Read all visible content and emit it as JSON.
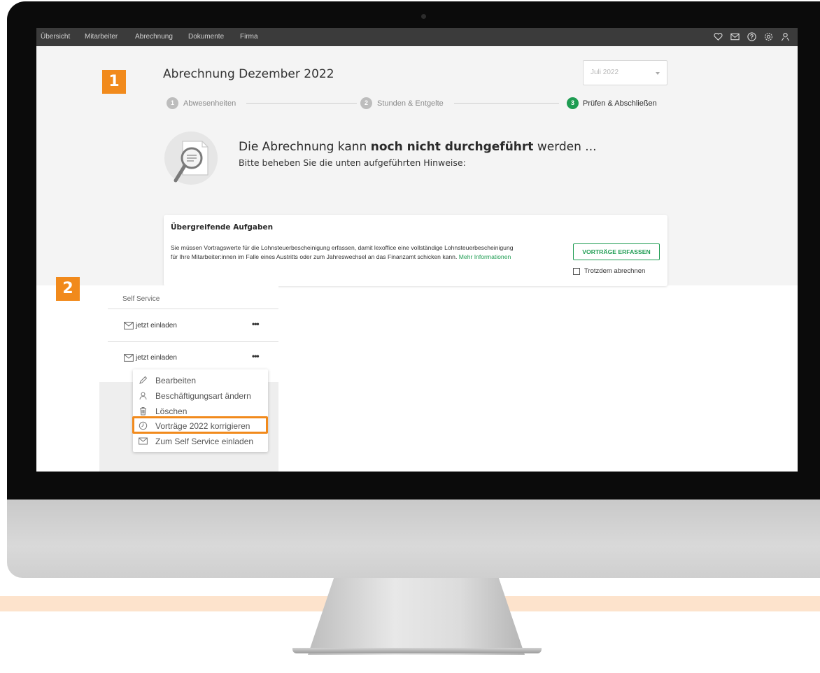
{
  "nav": {
    "items": [
      "Übersicht",
      "Mitarbeiter",
      "Abrechnung",
      "Dokumente",
      "Firma"
    ],
    "icons": [
      "heart-icon",
      "mail-icon",
      "help-icon",
      "settings-icon",
      "user-icon"
    ]
  },
  "badges": {
    "first": "1",
    "second": "2"
  },
  "page": {
    "title": "Abrechnung Dezember 2022",
    "month_select": "Juli 2022"
  },
  "stepper": {
    "steps": [
      {
        "number": "1",
        "label": "Abwesenheiten"
      },
      {
        "number": "2",
        "label": "Stunden & Entgelte"
      },
      {
        "number": "3",
        "label": "Prüfen & Abschließen"
      }
    ]
  },
  "notice": {
    "headline_pre": "Die Abrechnung kann ",
    "headline_bold": "noch nicht durchgeführt",
    "headline_post": " werden ...",
    "subline": "Bitte beheben Sie die unten aufgeführten Hinweise:"
  },
  "task": {
    "title": "Übergreifende Aufgaben",
    "text": "Sie müssen Vortragswerte für die Lohnsteuerbescheinigung erfassen, damit lexoffice eine vollständige Lohnsteuerbescheinigung für Ihre Mitarbeiter:innen im Falle eines Austritts oder zum Jahreswechsel an das Finanzamt schicken kann.",
    "link": "Mehr Informationen",
    "button": "VORTRÄGE ERFASSEN",
    "checkbox_label": "Trotzdem abrechnen"
  },
  "self_service": {
    "header": "Self Service",
    "rows": [
      {
        "label": "jetzt einladen",
        "more": "•••"
      },
      {
        "label": "jetzt einladen",
        "more": "•••"
      }
    ]
  },
  "menu": {
    "items": [
      {
        "label": "Bearbeiten",
        "icon": "pencil-icon"
      },
      {
        "label": "Beschäftigungsart ändern",
        "icon": "person-icon"
      },
      {
        "label": "Löschen",
        "icon": "trash-icon"
      },
      {
        "label": "Vorträge 2022 korrigieren",
        "icon": "clock-icon"
      },
      {
        "label": "Zum Self Service einladen",
        "icon": "envelope-icon"
      }
    ]
  },
  "colors": {
    "accent_orange": "#f18a1c",
    "success_green": "#1e9c52",
    "navbar": "#3b3b3b"
  }
}
